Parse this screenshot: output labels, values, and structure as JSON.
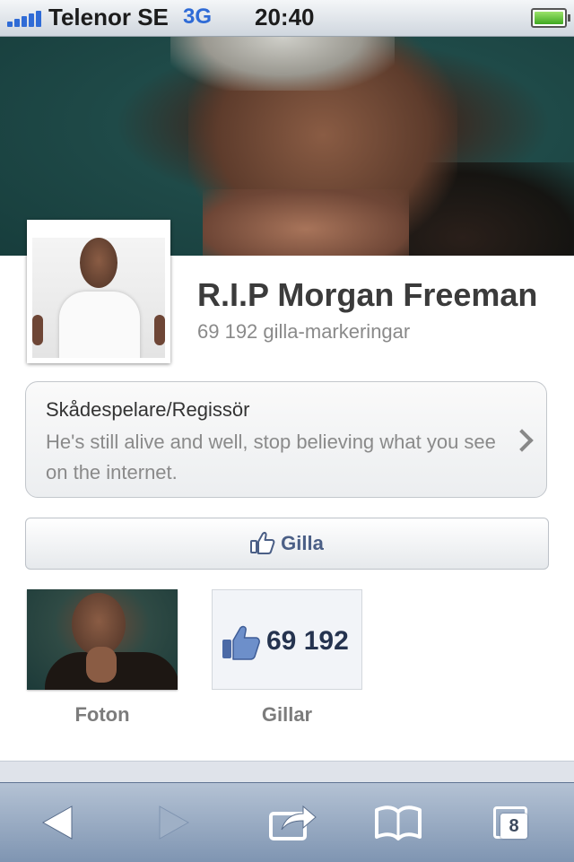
{
  "status_bar": {
    "carrier": "Telenor SE",
    "network": "3G",
    "time": "20:40"
  },
  "page": {
    "title": "R.I.P Morgan Freeman",
    "likes_text": "69 192 gilla-markeringar",
    "category": "Skådespelare/Regissör",
    "description": "He's still alive and well, stop believing what you see on the internet.",
    "like_button": "Gilla",
    "tiles": {
      "photos_label": "Foton",
      "likes_label": "Gillar",
      "likes_number": "69 192"
    }
  },
  "toolbar": {
    "tabs_count": "8",
    "icons": [
      "back-arrow-icon",
      "forward-arrow-icon",
      "share-icon",
      "bookmarks-icon",
      "tabs-icon"
    ]
  },
  "colors": {
    "link_blue": "#4b5f86",
    "signal_blue": "#2f6bd6",
    "toolbar": "#8a9fbb"
  }
}
